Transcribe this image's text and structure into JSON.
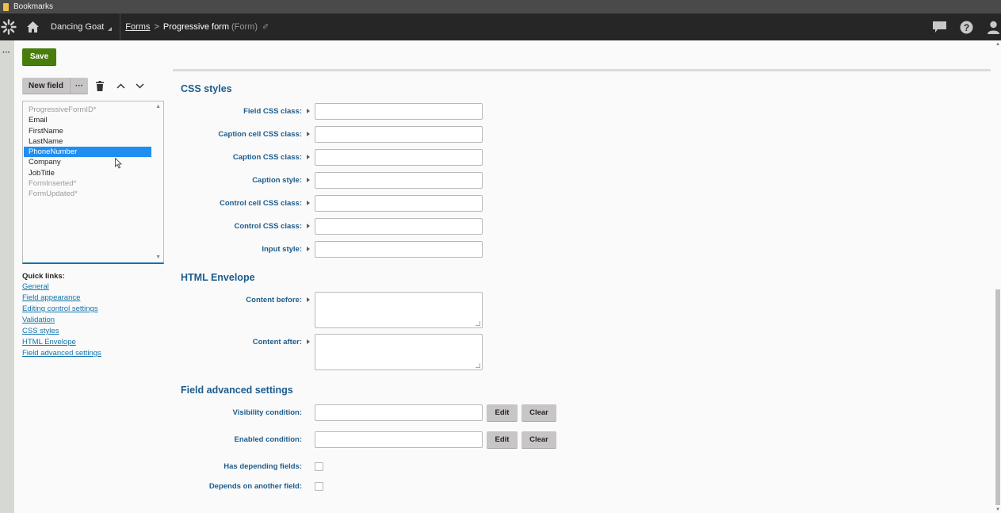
{
  "bookmarks_bar": {
    "label": "Bookmarks"
  },
  "header": {
    "logo_icon": "kentico-logo-icon",
    "home_icon": "home-icon",
    "site_name": "Dancing Goat",
    "breadcrumb": {
      "parent": "Forms",
      "separator": ">",
      "current": "Progressive form",
      "type": "(Form)"
    },
    "right_icons": [
      "chat-icon",
      "help-icon",
      "user-icon"
    ]
  },
  "toolbar": {
    "save_label": "Save",
    "save_color": "#497d0b"
  },
  "left_panel": {
    "new_field_label": "New field",
    "more_label": "···",
    "fields": [
      {
        "name": "ProgressiveFormID*",
        "system": true,
        "selected": false
      },
      {
        "name": "Email",
        "system": false,
        "selected": false
      },
      {
        "name": "FirstName",
        "system": false,
        "selected": false
      },
      {
        "name": "LastName",
        "system": false,
        "selected": false
      },
      {
        "name": "PhoneNumber",
        "system": false,
        "selected": true
      },
      {
        "name": "Company",
        "system": false,
        "selected": false
      },
      {
        "name": "JobTitle",
        "system": false,
        "selected": false
      },
      {
        "name": "FormInserted*",
        "system": true,
        "selected": false
      },
      {
        "name": "FormUpdated*",
        "system": true,
        "selected": false
      }
    ],
    "quick_links_title": "Quick links:",
    "quick_links": [
      "General",
      "Field appearance",
      "Editing control settings",
      "Validation",
      "CSS styles",
      "HTML Envelope",
      "Field advanced settings"
    ]
  },
  "form": {
    "css_styles": {
      "title": "CSS styles",
      "fields": [
        {
          "label": "Field CSS class:",
          "value": ""
        },
        {
          "label": "Caption cell CSS class:",
          "value": ""
        },
        {
          "label": "Caption CSS class:",
          "value": ""
        },
        {
          "label": "Caption style:",
          "value": ""
        },
        {
          "label": "Control cell CSS class:",
          "value": ""
        },
        {
          "label": "Control CSS class:",
          "value": ""
        },
        {
          "label": "Input style:",
          "value": ""
        }
      ]
    },
    "html_envelope": {
      "title": "HTML Envelope",
      "fields": [
        {
          "label": "Content before:",
          "value": ""
        },
        {
          "label": "Content after:",
          "value": ""
        }
      ]
    },
    "advanced": {
      "title": "Field advanced settings",
      "visibility_label": "Visibility condition:",
      "visibility_value": "",
      "enabled_label": "Enabled condition:",
      "enabled_value": "",
      "edit_label": "Edit",
      "clear_label": "Clear",
      "has_depending_label": "Has depending fields:",
      "has_depending_checked": false,
      "depends_on_label": "Depends on another field:",
      "depends_on_checked": false
    }
  }
}
